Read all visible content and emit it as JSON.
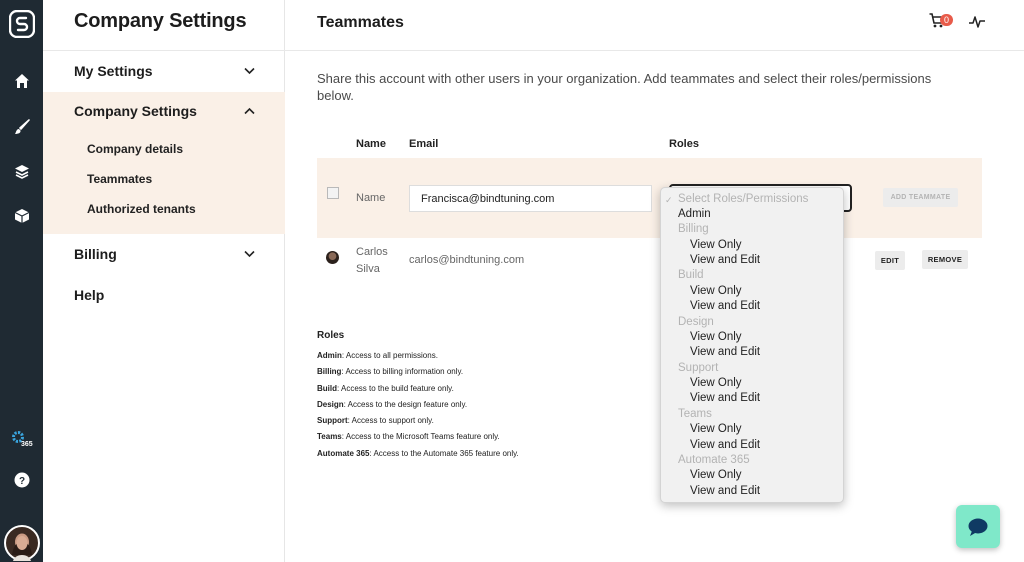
{
  "sidebar": {
    "title": "Company Settings",
    "items": [
      {
        "label": "My Settings"
      },
      {
        "label": "Company Settings"
      },
      {
        "label": "Billing"
      },
      {
        "label": "Help"
      }
    ],
    "sub_items": [
      {
        "label": "Company details"
      },
      {
        "label": "Teammates"
      },
      {
        "label": "Authorized tenants"
      }
    ]
  },
  "rail": {
    "icons": [
      "app-logo-icon",
      "home-icon",
      "brush-icon",
      "layers-icon",
      "cube-icon",
      "gear-365-icon",
      "help-icon",
      "user-avatar"
    ]
  },
  "header": {
    "title": "Teammates",
    "cart_count": "0"
  },
  "main": {
    "intro": "Share this account with other users in your organization. Add teammates and select their roles/permissions below.",
    "columns": {
      "name": "Name",
      "email": "Email",
      "roles": "Roles"
    },
    "new_row": {
      "name_placeholder": "Name",
      "email_value": "Francisca@bindtuning.com",
      "add_button": "ADD TEAMMATE"
    },
    "teammates": [
      {
        "name": "Carlos Silva",
        "email": "carlos@bindtuning.com",
        "edit": "EDIT",
        "remove": "REMOVE"
      }
    ],
    "roles_legend": {
      "title": "Roles",
      "items": [
        {
          "role": "Admin",
          "desc": ": Access to all permissions."
        },
        {
          "role": "Billing",
          "desc": ": Access to billing information only."
        },
        {
          "role": "Build",
          "desc": ": Access to the build feature only."
        },
        {
          "role": "Design",
          "desc": ": Access to the design feature only."
        },
        {
          "role": "Support",
          "desc": ": Access to support only."
        },
        {
          "role": "Teams",
          "desc": ": Access to the Microsoft Teams feature only."
        },
        {
          "role": "Automate 365",
          "desc": ": Access to the Automate 365 feature only."
        }
      ]
    }
  },
  "dropdown": {
    "placeholder": "Select Roles/Permissions",
    "top": "Admin",
    "groups": [
      {
        "label": "Billing",
        "options": [
          "View Only",
          "View and Edit"
        ]
      },
      {
        "label": "Build",
        "options": [
          "View Only",
          "View and Edit"
        ]
      },
      {
        "label": "Design",
        "options": [
          "View Only",
          "View and Edit"
        ]
      },
      {
        "label": "Support",
        "options": [
          "View Only",
          "View and Edit"
        ]
      },
      {
        "label": "Teams",
        "options": [
          "View Only",
          "View and Edit"
        ]
      },
      {
        "label": "Automate 365",
        "options": [
          "View Only",
          "View and Edit"
        ]
      }
    ]
  },
  "colors": {
    "rail_bg": "#1f2a33",
    "highlight_bg": "#faf0e7",
    "badge": "#e85b4a",
    "chat_bg": "#7fe8c9"
  }
}
